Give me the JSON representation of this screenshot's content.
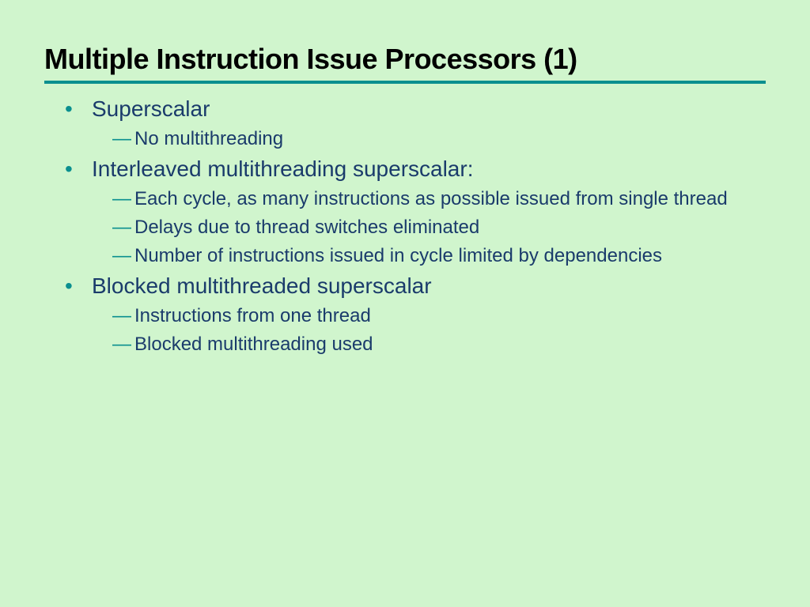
{
  "title": "Multiple Instruction Issue Processors (1)",
  "items": [
    {
      "label": "Superscalar",
      "sub": [
        "No multithreading"
      ]
    },
    {
      "label": "Interleaved multithreading superscalar:",
      "sub": [
        "Each cycle, as many instructions as possible issued from single thread",
        "Delays due to thread switches eliminated",
        "Number of instructions issued in cycle limited by dependencies"
      ]
    },
    {
      "label": "Blocked multithreaded superscalar",
      "sub": [
        "Instructions from one thread",
        "Blocked multithreading used"
      ]
    }
  ]
}
